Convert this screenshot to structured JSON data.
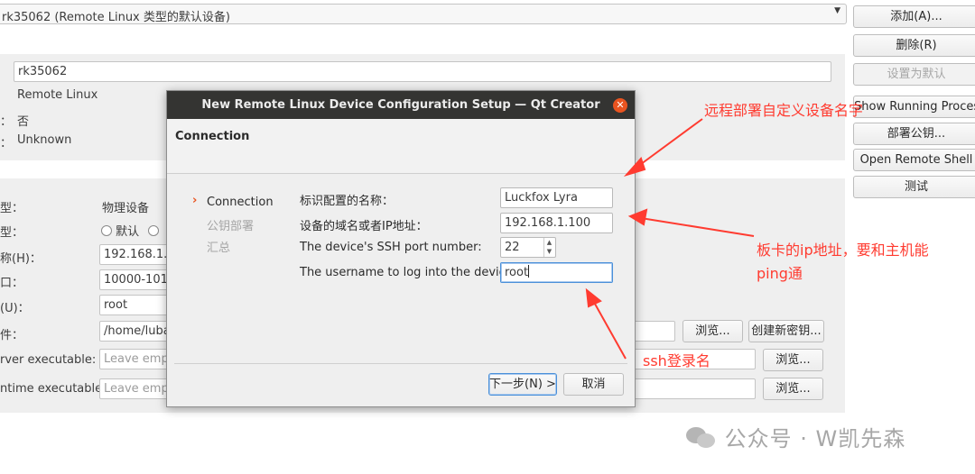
{
  "device_selector": {
    "value": "rk35062 (Remote Linux 类型的默认设备)"
  },
  "right_buttons": [
    {
      "label": "添加(A)...",
      "enabled": true
    },
    {
      "label": "删除(R)",
      "enabled": true
    },
    {
      "label": "设置为默认",
      "enabled": false
    },
    {
      "label": "Show Running Processes...",
      "enabled": true
    },
    {
      "label": "部署公钥...",
      "enabled": true
    },
    {
      "label": "Open Remote Shell",
      "enabled": true
    },
    {
      "label": "测试",
      "enabled": true
    }
  ],
  "general": {
    "name_value": "rk35062",
    "type_value": "Remote Linux",
    "auto_detected_label": "：",
    "auto_detected_value": "否",
    "state_label": "：",
    "state_value": "Unknown"
  },
  "config": {
    "machine_type_label": "型：",
    "machine_type_value": "物理设备",
    "auth_type_label": "型：",
    "auth_default": "默认",
    "host_label": "称(H)：",
    "host_value": "192.168.1.1",
    "free_ports_label": "口：",
    "free_ports_value": "10000-1010",
    "username_label": "(U)：",
    "username_value": "root",
    "key_file_label": "件：",
    "key_file_value": "/home/luba",
    "browse_label": "浏览...",
    "create_key_label": "创建新密钥...",
    "gdbserver_label": "rver executable:",
    "gdbserver_placeholder": "Leave empt",
    "qml_runtime_label": "ntime executable:",
    "qml_runtime_placeholder": "Leave empt"
  },
  "dialog": {
    "title": "New Remote Linux Device Configuration Setup — Qt Creator",
    "header": "Connection",
    "steps": [
      "Connection",
      "公钥部署",
      "汇总"
    ],
    "fields": {
      "name_label": "标识配置的名称：",
      "name_value": "Luckfox Lyra",
      "host_label": "设备的域名或者IP地址：",
      "host_value": "192.168.1.100",
      "port_label": "The device's SSH port number:",
      "port_value": "22",
      "user_label": "The username to log into the device:",
      "user_value": "root"
    },
    "next_button": "下一步(N) >",
    "cancel_button": "取消"
  },
  "annotations": {
    "name_note": "远程部署自定义设备名字",
    "ip_note_line1": "板卡的ip地址，要和主机能",
    "ip_note_line2": "ping通",
    "ssh_note": "ssh登录名",
    "color": "#ff3b30"
  },
  "watermark": {
    "text": "公众号 · W凯先森"
  }
}
